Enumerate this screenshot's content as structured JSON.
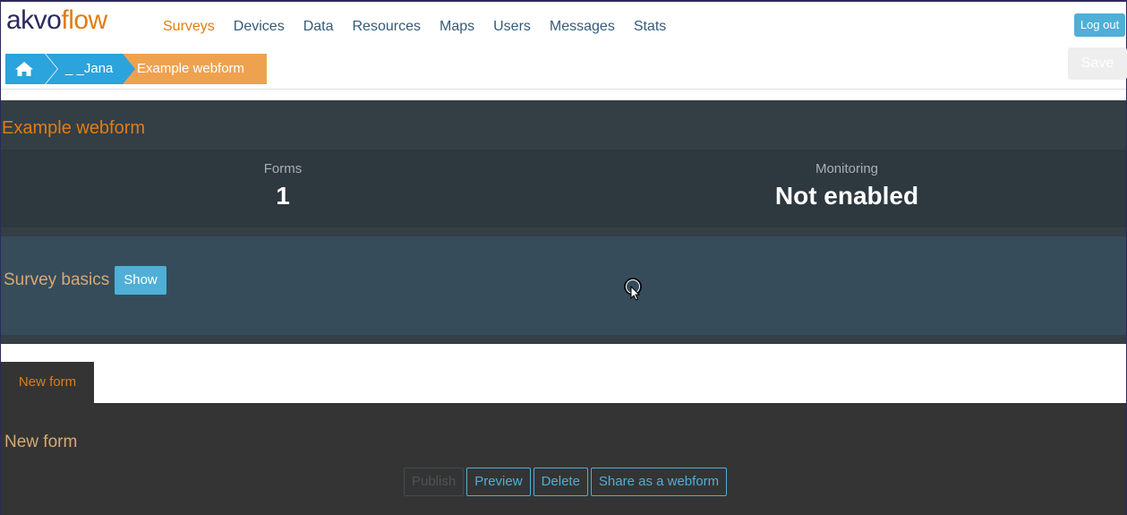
{
  "logo": {
    "part1": "akvo",
    "part2": "flow"
  },
  "nav": {
    "items": [
      "Surveys",
      "Devices",
      "Data",
      "Resources",
      "Maps",
      "Users",
      "Messages",
      "Stats"
    ],
    "active": "Surveys"
  },
  "header": {
    "logout_label": "Log out",
    "save_label": "Save"
  },
  "breadcrumb": {
    "user": "_ _Jana",
    "survey": "Example webform"
  },
  "survey": {
    "title": "Example webform",
    "forms_label": "Forms",
    "forms_value": "1",
    "monitoring_label": "Monitoring",
    "monitoring_value": "Not enabled",
    "basics_label": "Survey basics",
    "show_label": "Show"
  },
  "form": {
    "tab_label": "New form",
    "title": "New form",
    "actions": {
      "publish": "Publish",
      "preview": "Preview",
      "delete": "Delete",
      "share": "Share as a webform"
    }
  },
  "colors": {
    "brand_dark": "#2b2a5c",
    "brand_orange": "#e07d14",
    "accent_blue": "#4fafd6"
  }
}
